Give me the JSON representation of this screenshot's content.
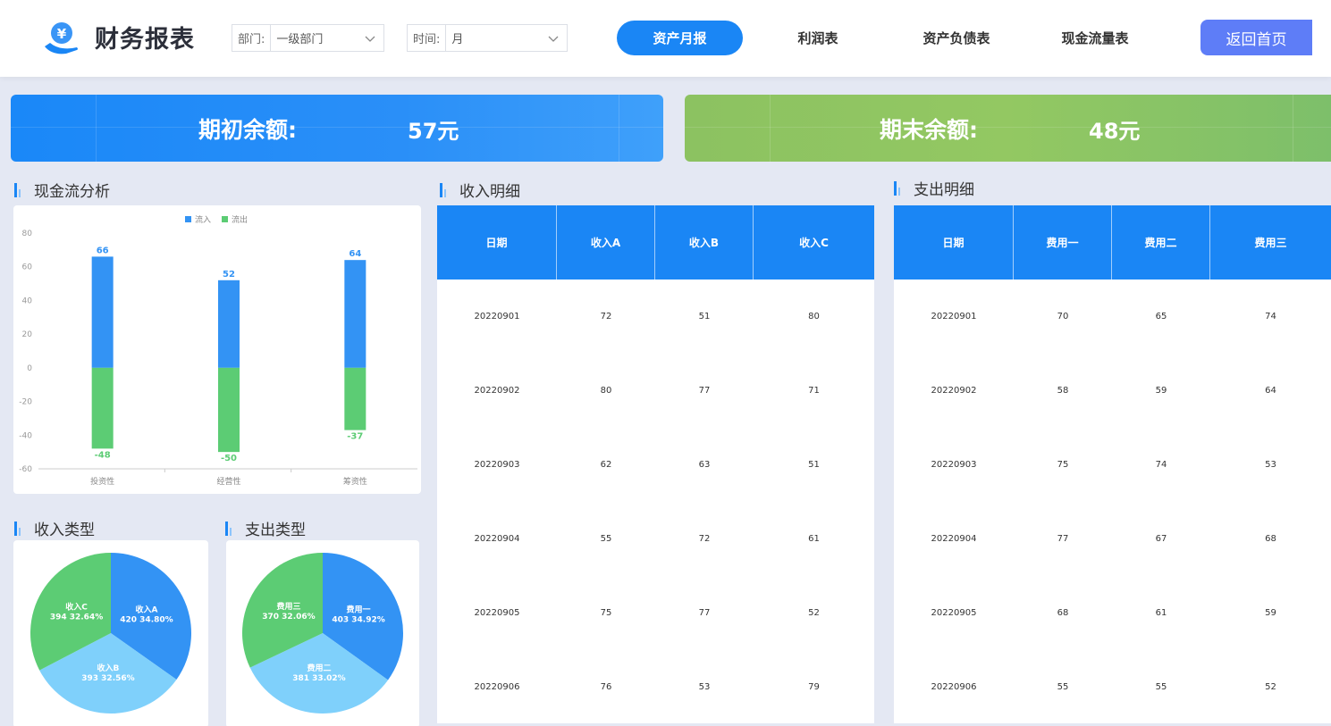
{
  "header": {
    "title": "财务报表",
    "dept_label": "部门:",
    "dept_value": "一级部门",
    "time_label": "时间:",
    "time_value": "月",
    "nav": [
      {
        "label": "资产月报",
        "active": true
      },
      {
        "label": "利润表",
        "active": false
      },
      {
        "label": "资产负债表",
        "active": false
      },
      {
        "label": "现金流量表",
        "active": false
      }
    ],
    "home_label": "返回首页"
  },
  "banners": {
    "opening": {
      "label": "期初余额:",
      "value": "57元"
    },
    "closing": {
      "label": "期末余额:",
      "value": "48元"
    }
  },
  "sections": {
    "cashflow": "现金流分析",
    "income_detail": "收入明细",
    "expense_detail": "支出明细",
    "income_type": "收入类型",
    "expense_type": "支出类型"
  },
  "chart_data": [
    {
      "type": "bar",
      "categories": [
        "投资性",
        "经营性",
        "筹资性"
      ],
      "series": [
        {
          "name": "流入",
          "values": [
            66,
            52,
            64
          ],
          "color": "#3393f4"
        },
        {
          "name": "流出",
          "values": [
            -48,
            -50,
            -37
          ],
          "color": "#5ccc74"
        }
      ],
      "ylim": [
        -60,
        80
      ],
      "yticks": [
        80,
        60,
        40,
        20,
        0,
        -20,
        -40,
        -60
      ],
      "legend": "top-center",
      "grid": false
    },
    {
      "type": "pie",
      "slices": [
        {
          "name": "收入A",
          "value": 420,
          "pct": "34.80%",
          "color": "#3393f4"
        },
        {
          "name": "收入B",
          "value": 393,
          "pct": "32.56%",
          "color": "#7fd0fb"
        },
        {
          "name": "收入C",
          "value": 394,
          "pct": "32.64%",
          "color": "#5ccc74"
        }
      ]
    },
    {
      "type": "pie",
      "slices": [
        {
          "name": "费用一",
          "value": 403,
          "pct": "34.92%",
          "color": "#3393f4"
        },
        {
          "name": "费用二",
          "value": 381,
          "pct": "33.02%",
          "color": "#7fd0fb"
        },
        {
          "name": "费用三",
          "value": 370,
          "pct": "32.06%",
          "color": "#5ccc74"
        }
      ]
    }
  ],
  "income_table": {
    "columns": [
      "日期",
      "收入A",
      "收入B",
      "收入C"
    ],
    "rows": [
      [
        "20220901",
        "72",
        "51",
        "80"
      ],
      [
        "20220902",
        "80",
        "77",
        "71"
      ],
      [
        "20220903",
        "62",
        "63",
        "51"
      ],
      [
        "20220904",
        "55",
        "72",
        "61"
      ],
      [
        "20220905",
        "75",
        "77",
        "52"
      ],
      [
        "20220906",
        "76",
        "53",
        "79"
      ]
    ]
  },
  "expense_table": {
    "columns": [
      "日期",
      "费用一",
      "费用二",
      "费用三"
    ],
    "rows": [
      [
        "20220901",
        "70",
        "65",
        "74"
      ],
      [
        "20220902",
        "58",
        "59",
        "64"
      ],
      [
        "20220903",
        "75",
        "74",
        "53"
      ],
      [
        "20220904",
        "77",
        "67",
        "68"
      ],
      [
        "20220905",
        "68",
        "61",
        "59"
      ],
      [
        "20220906",
        "55",
        "55",
        "52"
      ]
    ]
  }
}
